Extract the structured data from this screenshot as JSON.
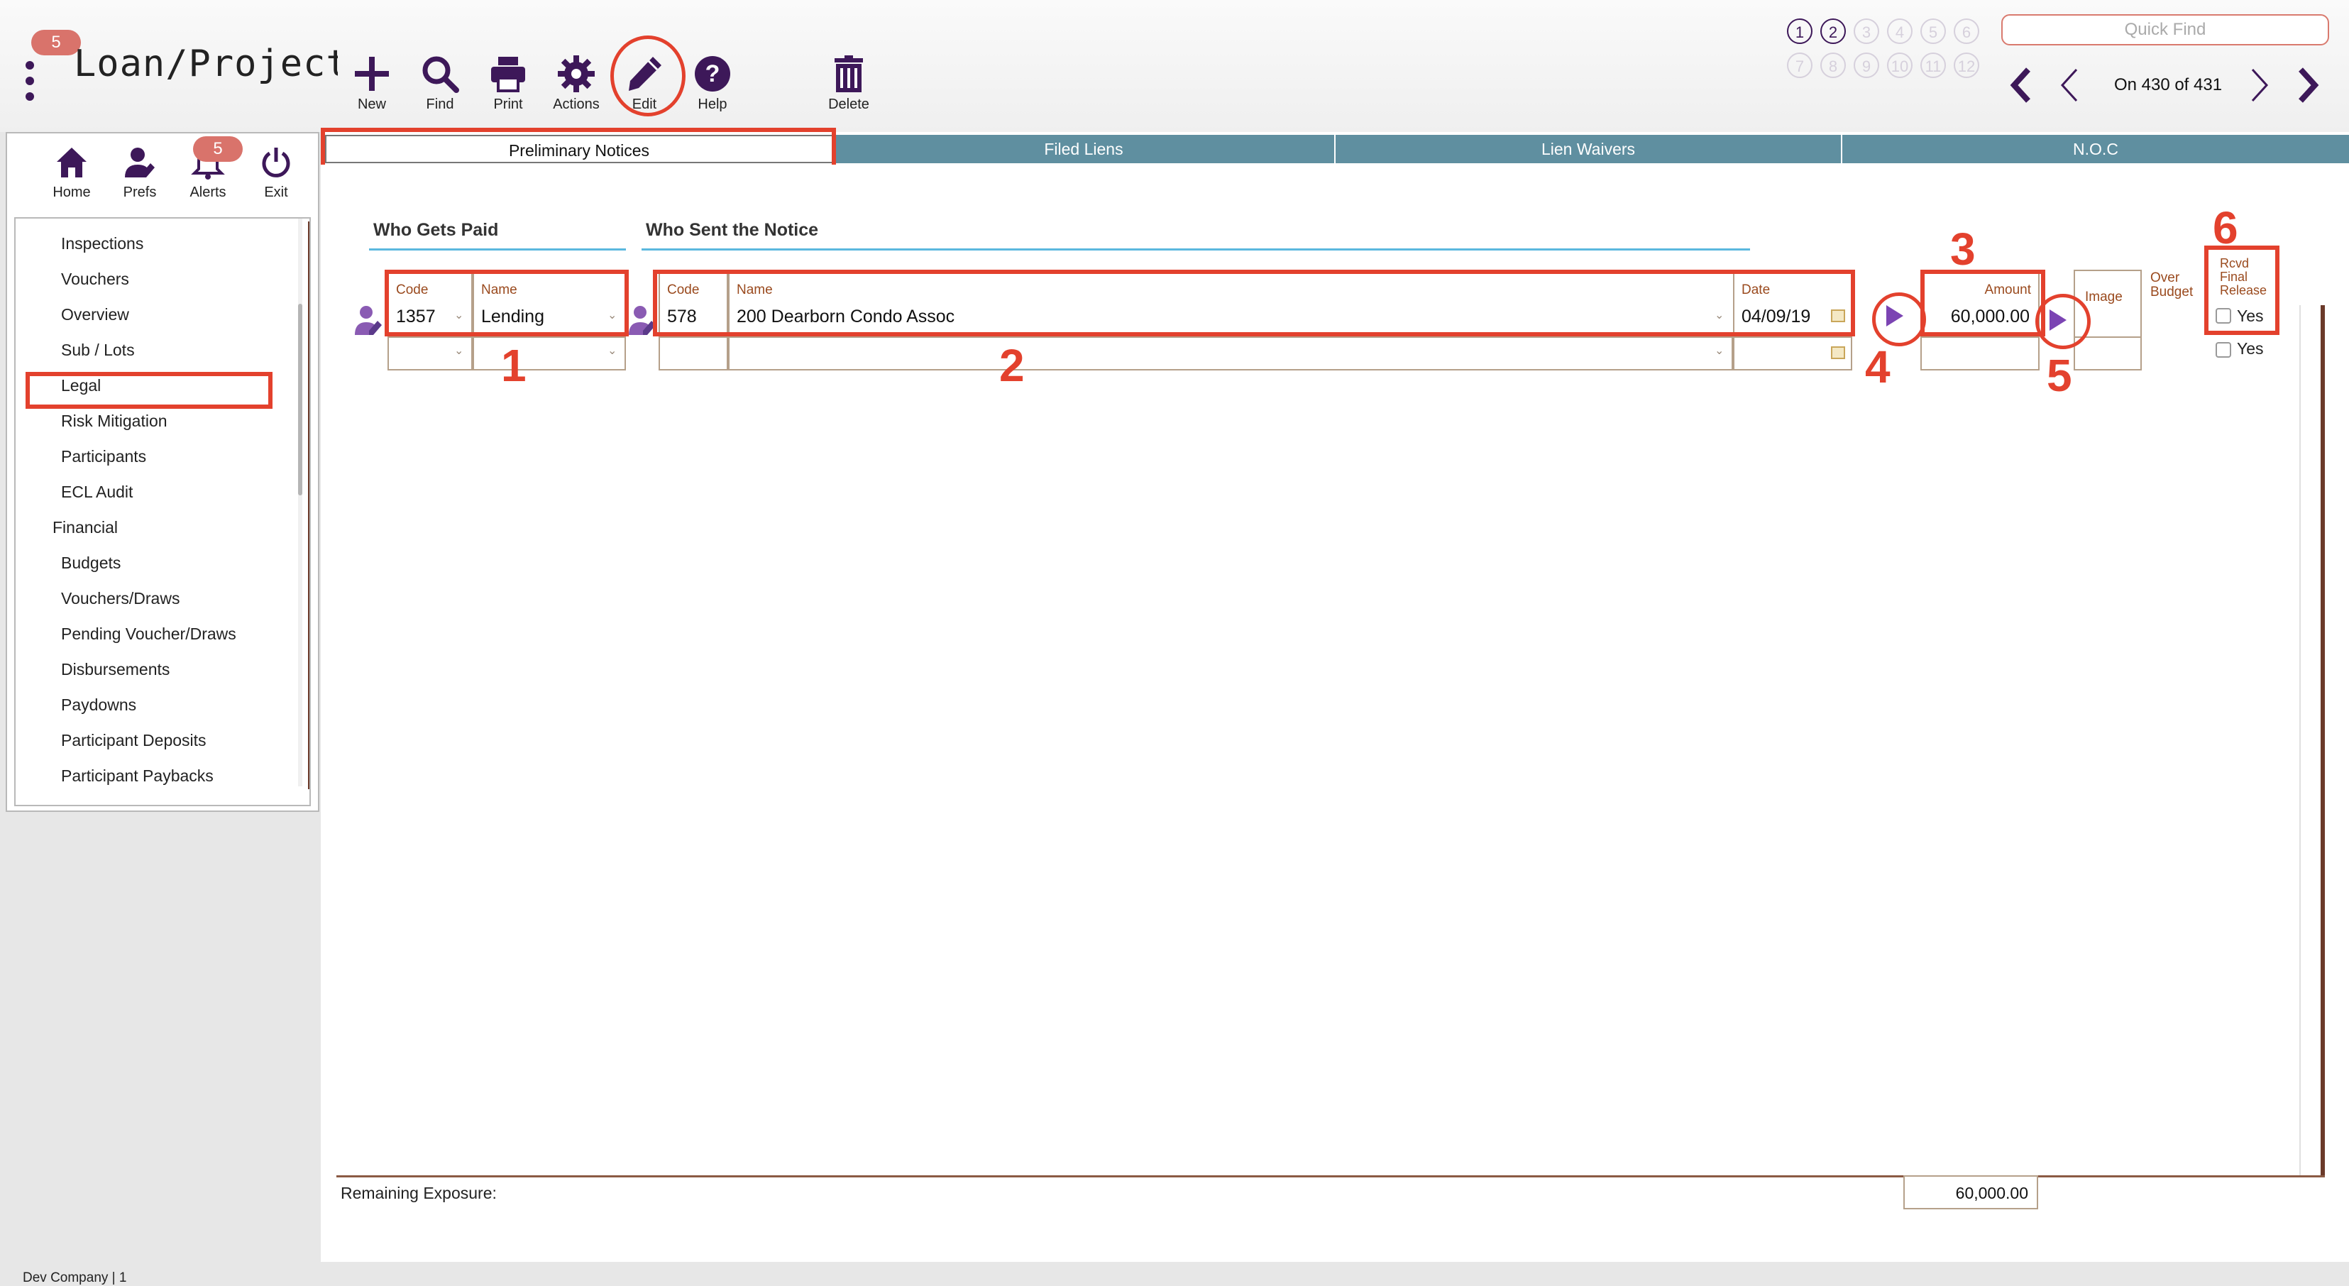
{
  "header": {
    "app_title": "Loan/ProjectL",
    "menu_badge": "5",
    "toolbar": [
      {
        "label": "New",
        "icon": "plus-icon"
      },
      {
        "label": "Find",
        "icon": "search-icon"
      },
      {
        "label": "Print",
        "icon": "printer-icon"
      },
      {
        "label": "Actions",
        "icon": "gear-icon"
      },
      {
        "label": "Edit",
        "icon": "pencil-icon"
      },
      {
        "label": "Help",
        "icon": "help-icon"
      },
      {
        "label": "Delete",
        "icon": "trash-icon"
      }
    ],
    "record_buttons": [
      "1",
      "2",
      "3",
      "4",
      "5",
      "6",
      "7",
      "8",
      "9",
      "10",
      "11",
      "12"
    ],
    "active_record_buttons": [
      "1",
      "2"
    ],
    "quick_find_placeholder": "Quick Find",
    "record_position": "On 430 of 431"
  },
  "side_menu": {
    "top_items": [
      {
        "label": "Home",
        "icon": "home-icon"
      },
      {
        "label": "Prefs",
        "icon": "user-edit-icon"
      },
      {
        "label": "Alerts",
        "icon": "bell-icon"
      },
      {
        "label": "Exit",
        "icon": "power-icon"
      }
    ],
    "alerts_badge": "5",
    "items": [
      "Inspections",
      "Vouchers",
      "Overview",
      "Sub / Lots",
      "Legal",
      "Risk Mitigation",
      "Participants",
      "ECL Audit",
      "Financial",
      "Budgets",
      "Vouchers/Draws",
      "Pending Voucher/Draws",
      "Disbursements",
      "Paydowns",
      "Participant Deposits",
      "Participant Paybacks"
    ],
    "selected_item": "Legal"
  },
  "tabs": [
    "Preliminary Notices",
    "Filed Liens",
    "Lien Waivers",
    "N.O.C"
  ],
  "active_tab": "Preliminary Notices",
  "form": {
    "who_gets_paid": "Who Gets Paid",
    "who_sent_notice": "Who Sent the Notice",
    "labels": {
      "code": "Code",
      "name": "Name",
      "date": "Date",
      "amount": "Amount",
      "image": "Image",
      "over_budget_1": "Over",
      "over_budget_2": "Budget",
      "rcvd_1": "Rcvd",
      "rcvd_2": "Final",
      "rcvd_3": "Release",
      "yes": "Yes"
    },
    "row1": {
      "payee_code": "1357",
      "payee_name": "Lending",
      "sender_code": "578",
      "sender_name": "200 Dearborn Condo Assoc",
      "date": "04/09/19",
      "amount": "60,000.00"
    },
    "remaining_exposure_label": "Remaining Exposure:",
    "remaining_exposure_value": "60,000.00"
  },
  "annotations": [
    "1",
    "2",
    "3",
    "4",
    "5",
    "6"
  ],
  "footer": "Dev Company | 1",
  "colors": {
    "accent": "#3d1859",
    "tab": "#5f8fa0",
    "highlight": "#e3412d",
    "field_caption": "#9a4a1e"
  }
}
